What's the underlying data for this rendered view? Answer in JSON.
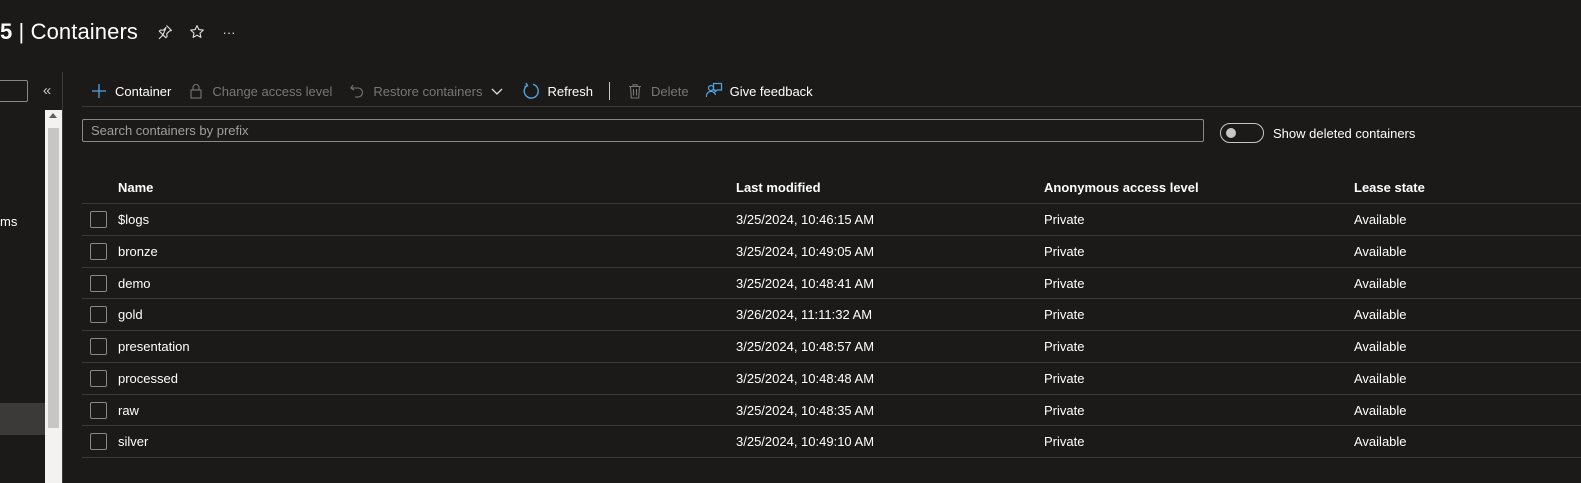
{
  "header": {
    "title_prefix": "5",
    "title_separator": " | ",
    "title": "Containers",
    "more_label": "···"
  },
  "icons": {
    "pin": "pin-icon",
    "star": "star-icon",
    "more": "more-icon",
    "collapse": "collapse-icon",
    "add": "plus-icon",
    "lock": "lock-icon",
    "restore": "undo-icon",
    "chevron": "chevron-down-icon",
    "refresh": "refresh-icon",
    "delete": "trash-icon",
    "feedback": "feedback-icon"
  },
  "sidebar": {
    "collapse_label": "«",
    "visible_item_fragment": "ms"
  },
  "toolbar": {
    "add_container": "Container",
    "change_access": "Change access level",
    "restore": "Restore containers",
    "refresh": "Refresh",
    "delete": "Delete",
    "feedback": "Give feedback"
  },
  "search": {
    "placeholder": "Search containers by prefix",
    "value": ""
  },
  "toggle": {
    "label": "Show deleted containers",
    "on": false
  },
  "table": {
    "headers": {
      "name": "Name",
      "last_modified": "Last modified",
      "access": "Anonymous access level",
      "lease": "Lease state"
    },
    "rows": [
      {
        "name": "$logs",
        "modified": "3/25/2024, 10:46:15 AM",
        "access": "Private",
        "lease": "Available"
      },
      {
        "name": "bronze",
        "modified": "3/25/2024, 10:49:05 AM",
        "access": "Private",
        "lease": "Available"
      },
      {
        "name": "demo",
        "modified": "3/25/2024, 10:48:41 AM",
        "access": "Private",
        "lease": "Available"
      },
      {
        "name": "gold",
        "modified": "3/26/2024, 11:11:32 AM",
        "access": "Private",
        "lease": "Available"
      },
      {
        "name": "presentation",
        "modified": "3/25/2024, 10:48:57 AM",
        "access": "Private",
        "lease": "Available"
      },
      {
        "name": "processed",
        "modified": "3/25/2024, 10:48:48 AM",
        "access": "Private",
        "lease": "Available"
      },
      {
        "name": "raw",
        "modified": "3/25/2024, 10:48:35 AM",
        "access": "Private",
        "lease": "Available"
      },
      {
        "name": "silver",
        "modified": "3/25/2024, 10:49:10 AM",
        "access": "Private",
        "lease": "Available"
      }
    ]
  },
  "colors": {
    "background": "#1b1a19",
    "accent": "#4fa3e0",
    "disabled_text": "#797775",
    "border": "#3b3a39"
  }
}
